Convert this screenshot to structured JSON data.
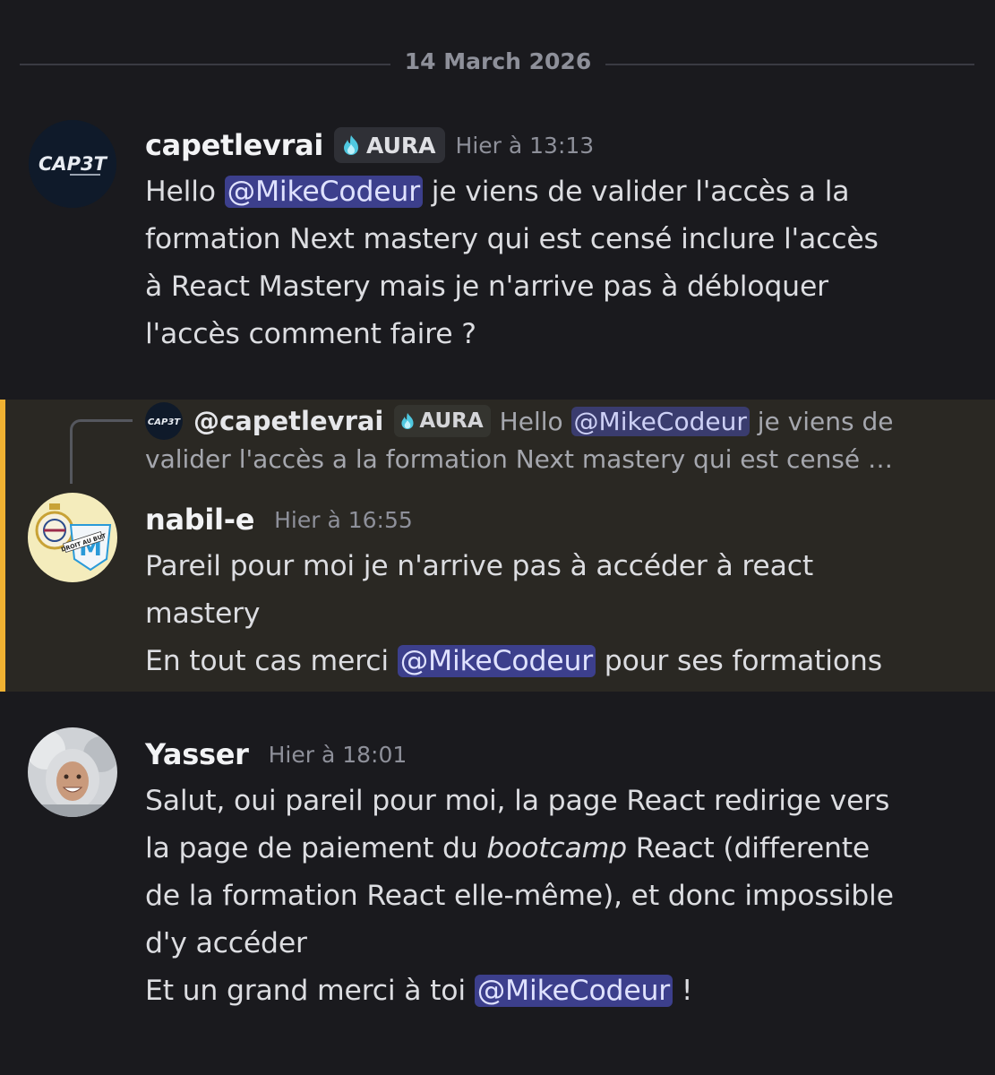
{
  "date_divider": "14 March 2026",
  "messages": [
    {
      "author": "capetlevrai",
      "avatar_text": "CAP3T",
      "tag": "AURA",
      "timestamp": "Hier à 13:13",
      "lines": [
        {
          "pre": "Hello ",
          "mention": "@MikeCodeur",
          "post": " je viens de valider l'accès a la"
        },
        {
          "text": "formation Next mastery qui est censé inclure l'accès"
        },
        {
          "text": "à React Mastery mais je n'arrive pas à débloquer"
        },
        {
          "text": "l'accès comment faire ?"
        }
      ]
    },
    {
      "author": "nabil-e",
      "avatar_text": "DROIT AU BUT",
      "timestamp": "Hier à 16:55",
      "reply": {
        "author": "@capetlevrai",
        "tag": "AURA",
        "pre": "Hello ",
        "mention": "@MikeCodeur",
        "post": " je viens de",
        "continuation": "valider l'accès a la formation Next mastery qui est censé …"
      },
      "lines": [
        {
          "text": "Pareil pour moi je n'arrive pas à accéder à react"
        },
        {
          "text": "mastery"
        },
        {
          "pre": "En tout cas merci ",
          "mention": "@MikeCodeur",
          "post": " pour ses formations"
        }
      ]
    },
    {
      "author": "Yasser",
      "timestamp": "Hier à 18:01",
      "lines": [
        {
          "text": "Salut, oui pareil pour moi, la page React redirige vers"
        },
        {
          "pre": "la page de paiement du ",
          "em": "bootcamp",
          "post": " React (differente"
        },
        {
          "text": "de la formation React elle-même), et donc impossible"
        },
        {
          "text": "d'y accéder"
        },
        {
          "pre": "Et un grand merci à toi ",
          "mention": "@MikeCodeur",
          "post": " !"
        }
      ]
    }
  ],
  "colors": {
    "background": "#1a1a1e",
    "highlight_background": "#2a2823",
    "highlight_bar": "#f0b232",
    "mention_background": "#3c3f8c"
  },
  "icons": {
    "tag_icon": "aura-flame-icon"
  }
}
